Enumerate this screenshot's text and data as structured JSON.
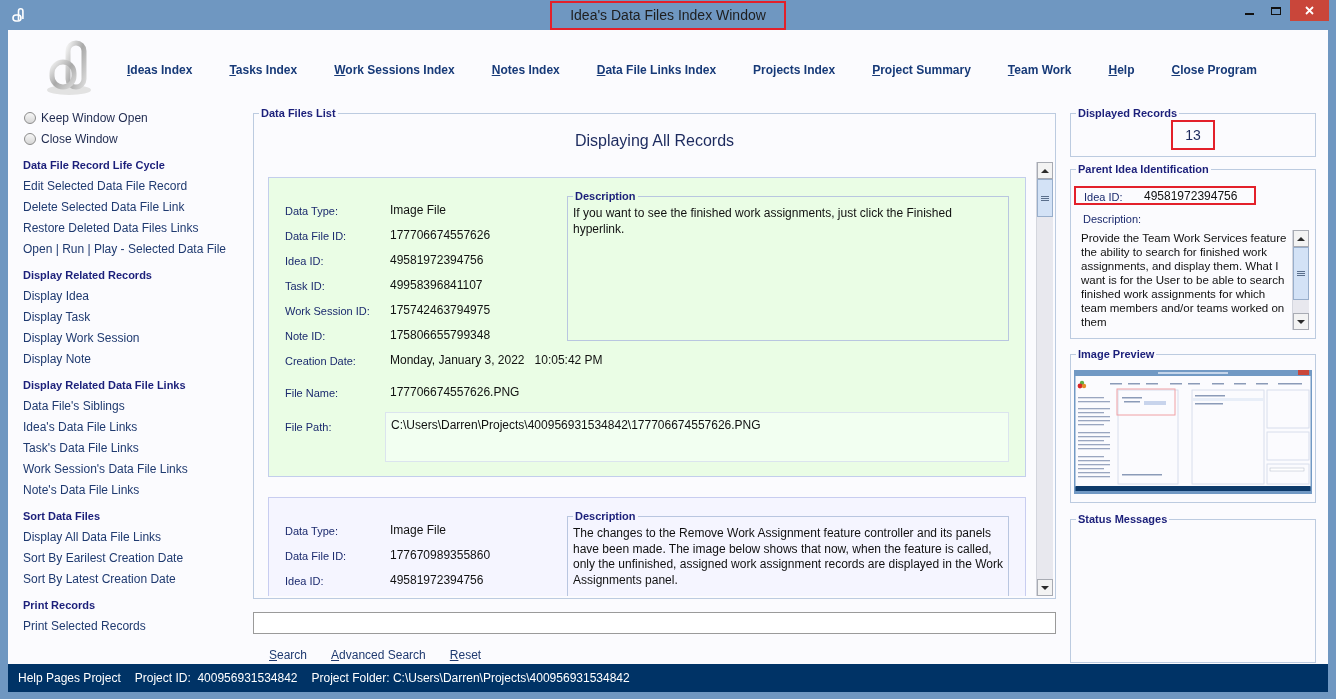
{
  "window": {
    "title": "Idea's Data Files Index Window",
    "highlighted": true
  },
  "menu": [
    {
      "label": "Ideas Index",
      "access_key": true
    },
    {
      "label": "Tasks Index",
      "access_key": true
    },
    {
      "label": "Work Sessions Index",
      "access_key": true
    },
    {
      "label": "Notes Index",
      "access_key": true
    },
    {
      "label": "Data File Links Index",
      "access_key": true
    },
    {
      "label": "Projects Index",
      "access_key": false
    },
    {
      "label": "Project Summary",
      "access_key": true
    },
    {
      "label": "Team Work",
      "access_key": true
    },
    {
      "label": "Help",
      "access_key": true
    },
    {
      "label": "Close Program",
      "access_key": true
    }
  ],
  "window_options": [
    {
      "label": "Keep Window Open",
      "selected": false
    },
    {
      "label": "Close Window",
      "selected": false
    }
  ],
  "sidebar": [
    {
      "heading": "Data File Record Life Cycle",
      "items": [
        "Edit Selected Data File Record",
        "Delete Selected Data File Link",
        "Restore Deleted Data Files Links",
        "Open | Run | Play - Selected Data File"
      ]
    },
    {
      "heading": "Display Related Records",
      "items": [
        "Display Idea",
        "Display Task",
        "Display Work Session",
        "Display Note"
      ]
    },
    {
      "heading": "Display Related Data File Links",
      "items": [
        "Data File's Siblings",
        "Idea's Data File Links",
        "Task's Data File Links",
        "Work Session's Data File Links",
        "Note's Data File Links"
      ]
    },
    {
      "heading": "Sort Data Files",
      "items": [
        "Display All Data File Links",
        "Sort By Earilest Creation Date",
        "Sort By Latest Creation Date"
      ]
    },
    {
      "heading": "Print Records",
      "items": [
        "Print Selected Records"
      ]
    }
  ],
  "data_files_list": {
    "title": "Data Files List",
    "heading": "Displaying All Records",
    "records": [
      {
        "selected": true,
        "fields": [
          {
            "label": "Data Type:",
            "value": "Image File"
          },
          {
            "label": "Data File ID:",
            "value": "177706674557626"
          },
          {
            "label": "Idea ID:",
            "value": "49581972394756"
          },
          {
            "label": "Task ID:",
            "value": "49958396841107"
          },
          {
            "label": "Work Session ID:",
            "value": "175742463794975"
          },
          {
            "label": "Note ID:",
            "value": "175806655799348"
          }
        ],
        "creation": {
          "label": "Creation Date:",
          "date": "Monday, January 3, 2022",
          "time": "10:05:42 PM"
        },
        "file_name": {
          "label": "File Name:",
          "value": "177706674557626.PNG"
        },
        "file_path": {
          "label": "File Path:",
          "value": "C:\\Users\\Darren\\Projects\\400956931534842\\177706674557626.PNG"
        },
        "description": {
          "title": "Description",
          "text": "If you want to see the finished work assignments, just click the Finished hyperlink."
        }
      },
      {
        "selected": false,
        "fields": [
          {
            "label": "Data Type:",
            "value": "Image File"
          },
          {
            "label": "Data File ID:",
            "value": "177670989355860"
          },
          {
            "label": "Idea ID:",
            "value": "49581972394756"
          }
        ],
        "description": {
          "title": "Description",
          "text": "The changes to the Remove Work Assignment feature controller and its panels have been made. The image below shows that now, when the feature is called, only the unfinished, assigned work assignment records are displayed in the Work Assignments panel."
        }
      }
    ]
  },
  "search_links": [
    {
      "label": "Search",
      "access_key": true
    },
    {
      "label": "Advanced Search",
      "access_key": true
    },
    {
      "label": "Reset",
      "access_key": true
    }
  ],
  "displayed_records": {
    "title": "Displayed Records",
    "count": "13",
    "highlighted": true
  },
  "parent_idea": {
    "title": "Parent Idea Identification",
    "idea_id_label": "Idea ID:",
    "idea_id": "49581972394756",
    "highlighted": true,
    "description_label": "Description:",
    "description": "Provide the Team Work Services feature the ability to search for finished work assignments, and display them. What I want is for the User to be able to search finished work assignments for which team members and/or teams worked on them"
  },
  "image_preview": {
    "title": "Image Preview"
  },
  "status_messages": {
    "title": "Status Messages"
  },
  "status_bar": [
    "Help Pages Project",
    "Project ID:  400956931534842",
    "Project Folder: C:\\Users\\Darren\\Projects\\400956931534842"
  ]
}
